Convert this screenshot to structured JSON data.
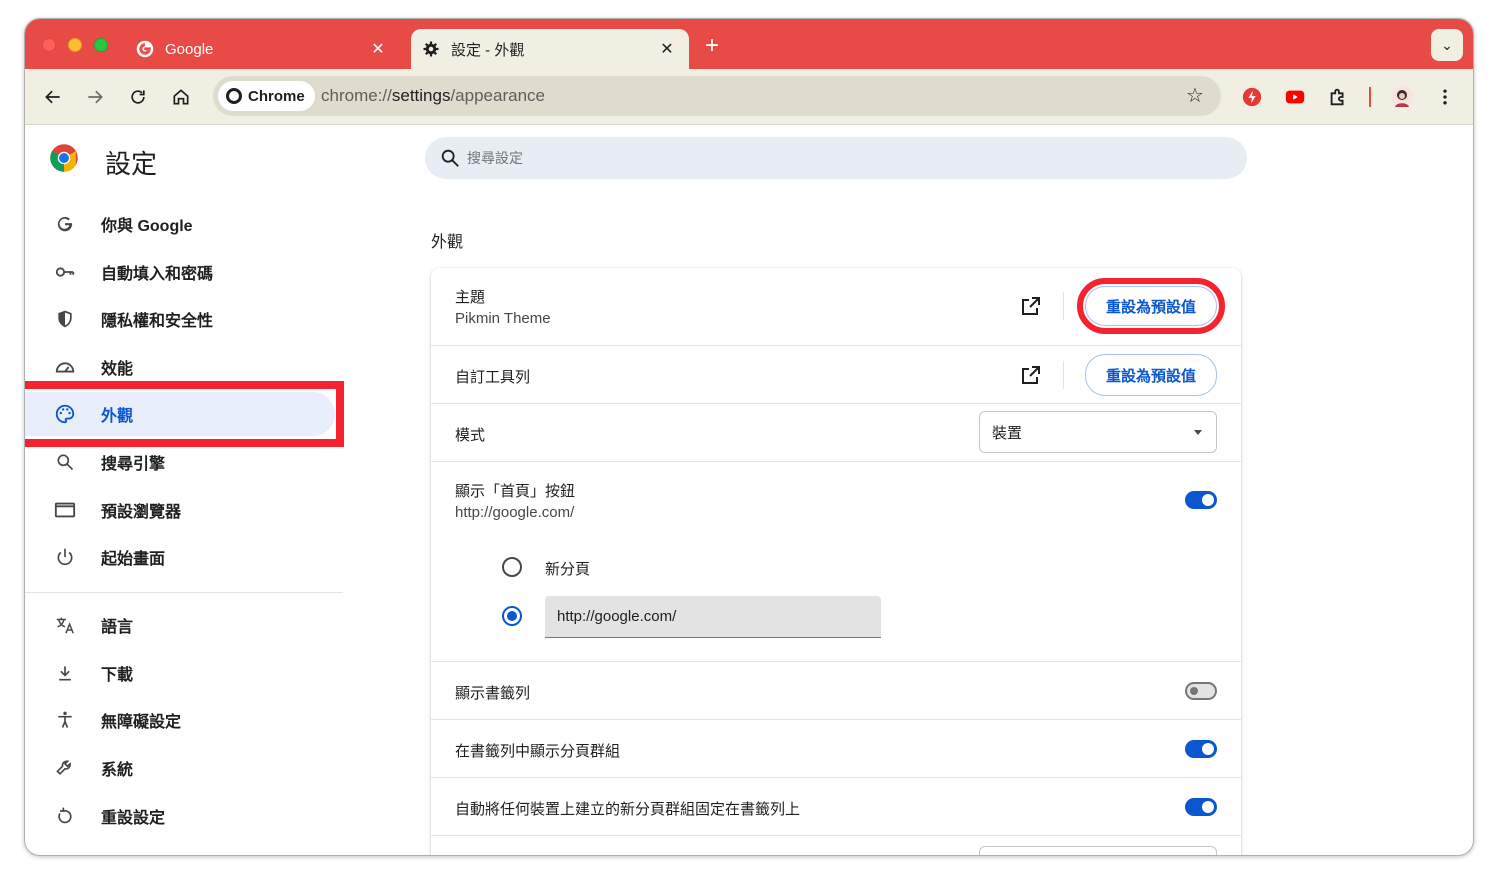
{
  "tabs": [
    {
      "title": "Google",
      "close": "✕"
    },
    {
      "title": "設定 - 外觀",
      "close": "✕"
    }
  ],
  "new_tab": "+",
  "tab_menu": "⌄",
  "omnibox": {
    "chip_label": "Chrome",
    "url_prefix": "chrome://",
    "url_host": "settings",
    "url_path": "/appearance"
  },
  "settings": {
    "title": "設定",
    "search_placeholder": "搜尋設定"
  },
  "sidebar": {
    "items": [
      {
        "label": "你與 Google",
        "icon": "google-g-icon"
      },
      {
        "label": "自動填入和密碼",
        "icon": "key-icon"
      },
      {
        "label": "隱私權和安全性",
        "icon": "shield-icon"
      },
      {
        "label": "效能",
        "icon": "speedometer-icon"
      },
      {
        "label": "外觀",
        "icon": "palette-icon"
      },
      {
        "label": "搜尋引擎",
        "icon": "search-icon"
      },
      {
        "label": "預設瀏覽器",
        "icon": "browser-window-icon"
      },
      {
        "label": "起始畫面",
        "icon": "power-icon"
      },
      {
        "label": "語言",
        "icon": "translate-icon"
      },
      {
        "label": "下載",
        "icon": "download-icon"
      },
      {
        "label": "無障礙設定",
        "icon": "accessibility-icon"
      },
      {
        "label": "系統",
        "icon": "wrench-icon"
      },
      {
        "label": "重設設定",
        "icon": "reset-icon"
      }
    ],
    "active_index": 4
  },
  "appearance": {
    "section_title": "外觀",
    "theme_label": "主題",
    "theme_value": "Pikmin Theme",
    "reset_label": "重設為預設值",
    "toolbar_label": "自訂工具列",
    "mode_label": "模式",
    "mode_value": "裝置",
    "home_label": "顯示「首頁」按鈕",
    "home_url": "http://google.com/",
    "home_on": true,
    "radio_newtab": "新分頁",
    "radio_url_value": "http://google.com/",
    "bookmarks_label": "顯示書籤列",
    "bookmarks_on": false,
    "tabgroups_label": "在書籤列中顯示分頁群組",
    "tabgroups_on": true,
    "autopin_label": "自動將任何裝置上建立的新分頁群組固定在書籤列上",
    "autopin_on": true
  },
  "colors": {
    "tabstrip": "#e84a45",
    "toolbar": "#f1eee2",
    "accent_blue": "#0b57d0",
    "highlight_red": "#f5222f"
  }
}
